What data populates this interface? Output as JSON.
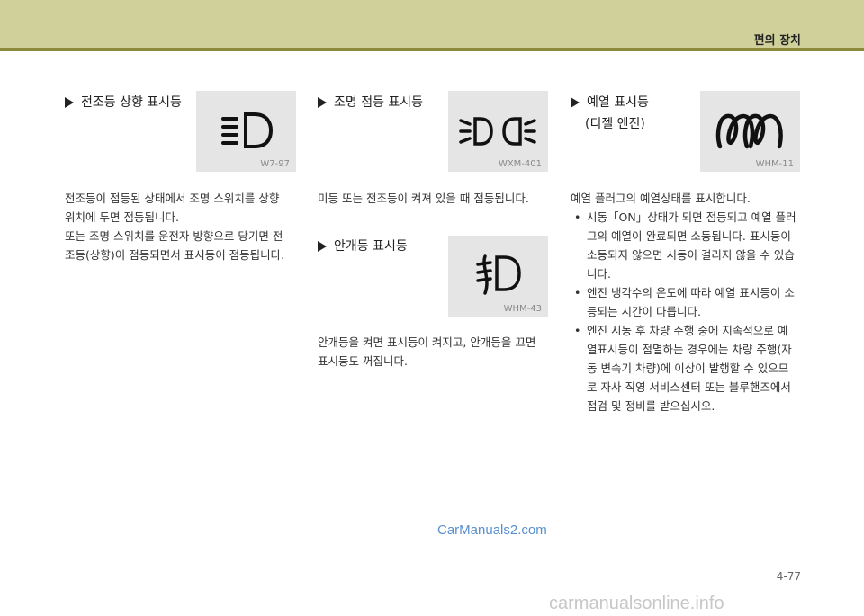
{
  "header": {
    "section": "편의 장치"
  },
  "col1": {
    "title": "전조등 상향 표시등",
    "icon": {
      "name": "high-beam-icon",
      "code": "W7-97"
    },
    "body": [
      "전조등이 점등된 상태에서 조명 스위치를 상향",
      "위치에 두면 점등됩니다.",
      "또는 조명 스위치를 운전자 방향으로 당기면 전",
      "조등(상향)이 점등되면서 표시등이 점등됩니다."
    ]
  },
  "col2": {
    "title": "조명 점등 표시등",
    "icon": {
      "name": "position-lamp-icon",
      "code": "WXM-401"
    },
    "body": "미등 또는 전조등이 켜져 있을 때 점등됩니다.",
    "title2": "안개등 표시등",
    "icon2": {
      "name": "fog-lamp-icon",
      "code": "WHM-43"
    },
    "body2": [
      "안개등을 켜면 표시등이 켜지고, 안개등을 끄면",
      "표시등도 꺼집니다."
    ]
  },
  "col3": {
    "title": "예열 표시등",
    "subtitle": "(디젤 엔진)",
    "icon": {
      "name": "glow-plug-icon",
      "code": "WHM-11"
    },
    "intro": "예열 플러그의 예열상태를 표시합니다.",
    "bullets": [
      [
        "시동「ON」상태가 되면 점등되고 예열 플러",
        "그의 예열이 완료되면 소등됩니다. 표시등이",
        "소등되지 않으면 시동이 걸리지 않을 수 있습",
        "니다."
      ],
      [
        "엔진 냉각수의 온도에 따라 예열 표시등이 소",
        "등되는 시간이 다릅니다."
      ],
      [
        "엔진 시동 후 차량 주행 중에 지속적으로 예",
        "열표시등이 점멸하는 경우에는 차량 주행(자",
        "동 변속기 차량)에 이상이 발행할 수 있으므",
        "로 자사 직영 서비스센터 또는 블루핸즈에서",
        "점검 및 정비를 받으십시오."
      ]
    ]
  },
  "footer": {
    "watermark": "CarManuals2.com",
    "page": "4-77",
    "site": "carmanualsonline.info"
  }
}
